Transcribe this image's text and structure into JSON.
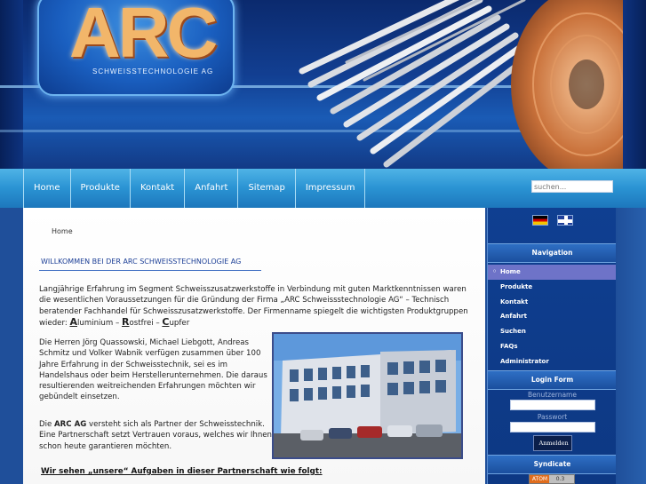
{
  "header": {
    "logo_text": "ARC",
    "logo_subtitle": "SCHWEISSTECHNOLOGIE AG"
  },
  "nav": {
    "items": [
      "Home",
      "Produkte",
      "Kontakt",
      "Anfahrt",
      "Sitemap",
      "Impressum"
    ],
    "search_placeholder": "suchen..."
  },
  "main": {
    "breadcrumb": "Home",
    "welcome": "WILLKOMMEN BEI DER ARC SCHWEISSTECHNOLOGIE AG",
    "intro": "Langjährige Erfahrung im Segment Schweisszusatzwerkstoffe in Verbindung mit guten Marktkenntnissen waren die wesentlichen Voraussetzungen für die Gründung der Firma „ARC Schweissstechnologie AG“ – Technisch beratender Fachhandel für Schweisszusatzwerkstoffe. Der Firmenname spiegelt die wichtigsten Produktgruppen wieder:",
    "products": [
      {
        "initial": "A",
        "rest": "luminium"
      },
      {
        "initial": "R",
        "rest": "ostfrei"
      },
      {
        "initial": "C",
        "rest": "upfer"
      }
    ],
    "partners": "Die Herren Jörg Quassowski, Michael Liebgott, Andreas Schmitz und Volker Wabnik verfügen zusammen über 100 Jahre Erfahrung in der Schweisstechnik, sei es im Handelshaus oder beim Herstellerunternehmen. Die daraus resultierenden weitreichenden Erfahrungen möchten wir gebündelt einsetzen.",
    "partner_statement_before": "Die ",
    "partner_statement_bold": "ARC AG",
    "partner_statement_after": " versteht sich als Partner der Schweisstechnik. Eine Partnerschaft setzt Vertrauen voraus, welches wir Ihnen schon heute garantieren möchten.",
    "tasks_heading": "Wir sehen „unsere“ Aufgaben in dieser Partnerschaft wie folgt:"
  },
  "sidebar": {
    "navigation_title": "Navigation",
    "links": [
      "Home",
      "Produkte",
      "Kontakt",
      "Anfahrt",
      "Suchen",
      "FAQs",
      "Administrator"
    ],
    "active_link": "Home",
    "login_title": "Login Form",
    "username_label": "Benutzername",
    "password_label": "Passwort",
    "login_button": "Anmelden",
    "syndicate_title": "Syndicate",
    "syndicate_badge_left": "ATOM",
    "syndicate_badge_right": "0.3"
  },
  "colors": {
    "nav_bar": "#2a93d3",
    "sidebar": "#0f3f91",
    "welcome_text": "#1c3f96",
    "logo_text": "#f2b66a"
  },
  "icons": {
    "flag_de": "german-flag-icon",
    "flag_en": "uk-flag-icon"
  }
}
